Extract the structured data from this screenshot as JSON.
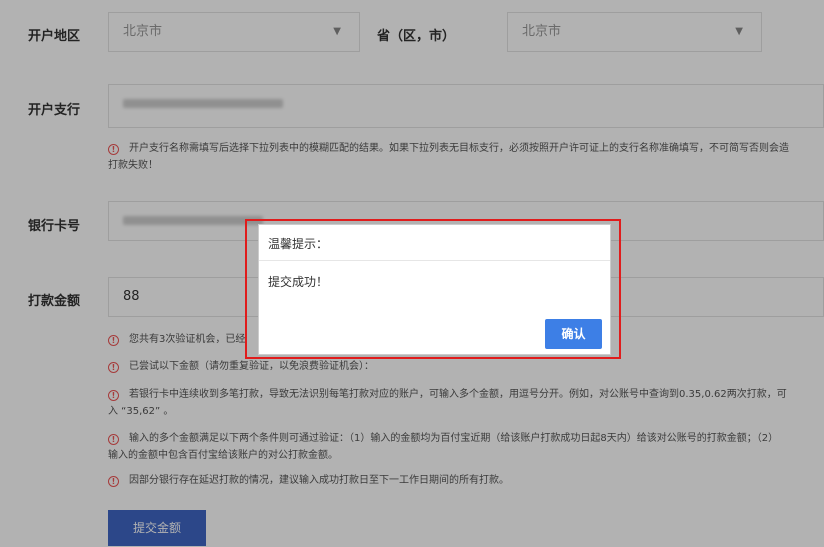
{
  "form": {
    "region_label": "开户地区",
    "province_value": "北京市",
    "province_suffix": "省（区，市）",
    "city_value": "北京市",
    "branch_label": "开户支行",
    "branch_note_line1": "开户支行名称需填写后选择下拉列表中的模糊匹配的结果。如果下拉列表无目标支行，必须按照开户许可证上的支行名称准确填写，不可简写否则会造",
    "branch_note_line2": "打款失败！",
    "card_label": "银行卡号",
    "amount_label": "打款金额",
    "amount_value": "88",
    "notes": [
      "您共有3次验证机会，已经",
      "已尝试以下金额（请勿重复验证，以免浪费验证机会）：",
      "若银行卡中连续收到多笔打款，导致无法识别每笔打款对应的账户，可输入多个金额，用逗号分开。例如，对公账号中查询到0.35,0.62两次打款，可",
      "入 “35,62” 。",
      "输入的多个金额满足以下两个条件则可通过验证：（1）输入的金额均为百付宝近期（给该账户打款成功日起8天内）给该对公账号的打款金额；（2）",
      "输入的金额中包含百付宝给该账户的对公打款金额。",
      "因部分银行存在延迟打款的情况，建议输入成功打款日至下一工作日期间的所有打款。"
    ],
    "submit_label": "提交金额"
  },
  "dialog": {
    "title": "温馨提示：",
    "message": "提交成功！",
    "confirm_label": "确认"
  },
  "colors": {
    "highlight_border": "#e01c1c",
    "confirm_button": "#3d7fe6",
    "submit_button": "#3f66c4",
    "warning": "#ee5555"
  }
}
